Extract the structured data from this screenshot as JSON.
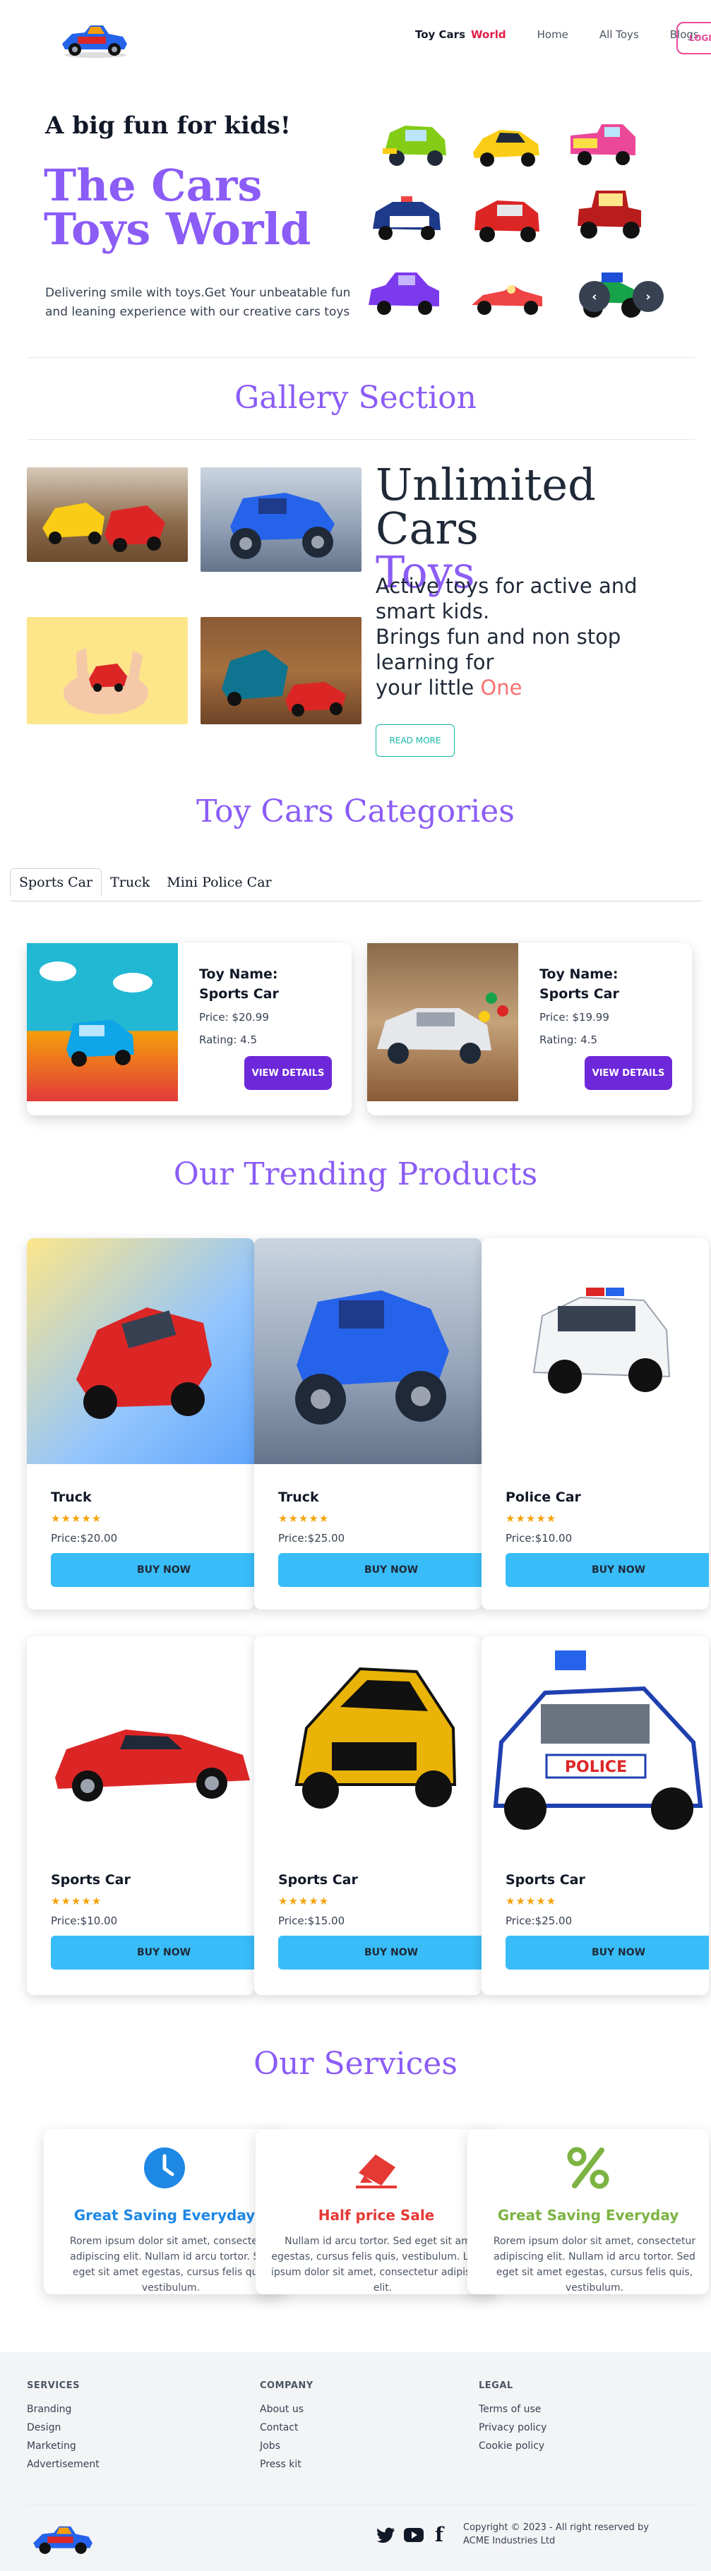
{
  "nav": {
    "brand": "Toy Cars",
    "brand_accent": "World",
    "links": [
      "Home",
      "All Toys",
      "Blogs"
    ],
    "login": "LOGIN"
  },
  "hero": {
    "subtitle": "A big fun for kids!",
    "title": "The Cars Toys World",
    "description": "Delivering smile with toys.Get Your unbeatable fun and leaning experience with our creative cars toys",
    "prev_icon": "‹",
    "next_icon": "›"
  },
  "gallery": {
    "title": "Gallery Section",
    "heading_line1": "Unlimited Cars",
    "heading_line2": "Toys",
    "text_line1": "Active toys for active and smart kids.",
    "text_line2": "Brings fun and non stop learning for",
    "text_line3": "your little",
    "text_accent": "One",
    "read_more": "READ MORE"
  },
  "categories": {
    "title": "Toy Cars Categories",
    "tabs": [
      "Sports Car",
      "Truck",
      "Mini Police Car"
    ],
    "cards": [
      {
        "name": "Toy Name: Sports Car",
        "price": "Price: $20.99",
        "rating": "Rating: 4.5",
        "button": "VIEW DETAILS"
      },
      {
        "name": "Toy Name: Sports Car",
        "price": "Price: $19.99",
        "rating": "Rating: 4.5",
        "button": "VIEW DETAILS"
      }
    ]
  },
  "trending": {
    "title": "Our Trending Products",
    "products": [
      {
        "name": "Truck",
        "stars": "★★★★★",
        "rating": 5,
        "price": "Price:$20.00",
        "button": "BUY NOW"
      },
      {
        "name": "Truck",
        "stars": "★★★★★",
        "rating": 5,
        "price": "Price:$25.00",
        "button": "BUY NOW"
      },
      {
        "name": "Police Car",
        "stars": "★★★★★",
        "rating": 5,
        "price": "Price:$10.00",
        "button": "BUY NOW"
      },
      {
        "name": "Sports Car",
        "stars": "★★★★★",
        "rating": 5,
        "price": "Price:$10.00",
        "button": "BUY NOW"
      },
      {
        "name": "Sports Car",
        "stars": "★★★★★",
        "rating": 5,
        "price": "Price:$15.00",
        "button": "BUY NOW"
      },
      {
        "name": "Sports Car",
        "stars": "★★★★★",
        "rating": 5,
        "price": "Price:$25.00",
        "button": "BUY NOW"
      }
    ]
  },
  "services": {
    "title": "Our Services",
    "items": [
      {
        "title": "Great Saving Everyday",
        "color": "#1e88e5",
        "icon": "clock-icon",
        "desc": "Rorem ipsum dolor sit amet, consectetur adipiscing elit. Nullam id arcu tortor. Sed eget sit amet egestas, cursus felis quis, vestibulum."
      },
      {
        "title": "Half price Sale",
        "color": "#e53935",
        "icon": "eraser-tag-icon",
        "desc": "Nullam id arcu tortor. Sed eget sit amet egestas, cursus felis quis, vestibulum. Lorem ipsum dolor sit amet, consectetur adipis cing elit."
      },
      {
        "title": "Great Saving Everyday",
        "color": "#7cb342",
        "icon": "percent-icon",
        "desc": "Rorem ipsum dolor sit amet, consectetur adipiscing elit. Nullam id arcu tortor. Sed eget sit amet egestas, cursus felis quis, vestibulum."
      }
    ]
  },
  "footer": {
    "columns": [
      {
        "title": "SERVICES",
        "links": [
          "Branding",
          "Design",
          "Marketing",
          "Advertisement"
        ]
      },
      {
        "title": "COMPANY",
        "links": [
          "About us",
          "Contact",
          "Jobs",
          "Press kit"
        ]
      },
      {
        "title": "LEGAL",
        "links": [
          "Terms of use",
          "Privacy policy",
          "Cookie policy"
        ]
      }
    ],
    "copyright": "Copyright © 2023 - All right reserved by ACME Industries Ltd",
    "social": [
      "twitter-icon",
      "youtube-icon",
      "facebook-icon"
    ],
    "social_glyph_f": "f"
  },
  "colors": {
    "accent_purple": "#8b5cf6",
    "accent_red": "#e11d48",
    "buy_blue": "#38bdf8",
    "view_purple": "#6d28d9"
  }
}
